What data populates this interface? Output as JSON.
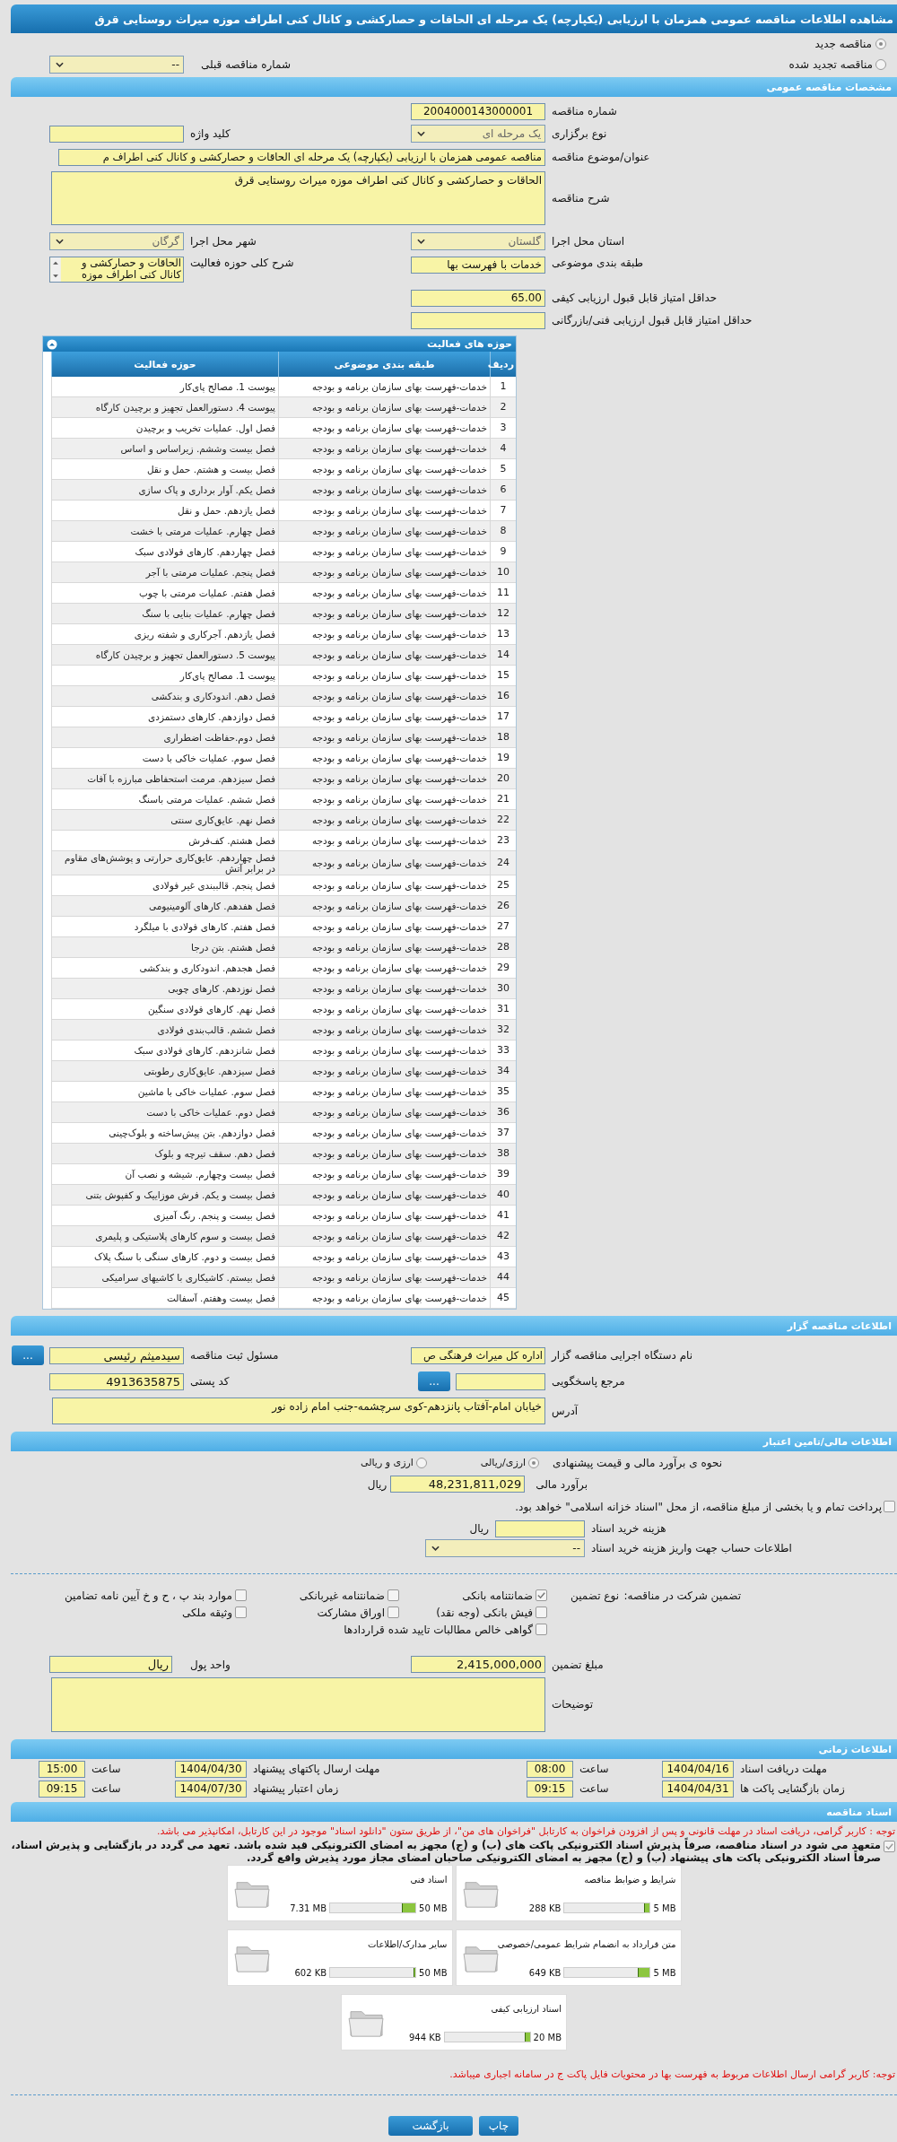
{
  "page_title": "مشاهده اطلاعات مناقصه عمومی همزمان با ارزیابی (یکپارچه) یک مرحله ای الحاقات و حصارکشی و کانال کنی اطراف موزه میراث روستایی قرق",
  "tender_kind": [
    {
      "label": "مناقصه جدید",
      "selected": true
    },
    {
      "label": "مناقصه تجدید شده",
      "selected": false
    }
  ],
  "previous_tender": {
    "label": "شماره مناقصه قبلی",
    "value": "--"
  },
  "general": {
    "header": "مشخصات مناقصه عمومی",
    "tender_number": {
      "label": "شماره مناقصه",
      "value": "2004000143000001"
    },
    "holding_type": {
      "label": "نوع برگزاری",
      "value": "یک مرحله ای"
    },
    "keyword": {
      "label": "کلید واژه"
    },
    "subject": {
      "label": "عنوان/موضوع مناقصه",
      "value": "مناقصه عمومی همزمان با ارزیابی (یکپارچه) یک مرحله ای الحاقات و حصارکشی و کانال کنی اطراف م"
    },
    "description": {
      "label": "شرح مناقصه",
      "value": "الحاقات و حصارکشی و کانال کنی اطراف موزه میراث روستایی قرق"
    },
    "province": {
      "label": "استان محل اجرا",
      "value": "گلستان"
    },
    "city": {
      "label": "شهر محل اجرا",
      "value": "گرگان"
    },
    "category": {
      "label": "طبقه بندی موضوعی",
      "value": "خدمات با فهرست بها"
    },
    "activity_summary": {
      "label": "شرح کلی حوزه فعالیت",
      "value": "الحاقات و حصارکشی و کانال کنی اطراف موزه"
    },
    "min_quality_score": {
      "label": "حداقل امتیاز قابل قبول ارزیابی کیفی",
      "value": "65.00"
    },
    "min_technical_score": {
      "label": "حداقل امتیاز قابل قبول ارزیابی فنی/بازرگانی"
    }
  },
  "activities": {
    "title": "حوزه های فعالیت",
    "columns": [
      "ردیف",
      "طبقه بندی موضوعی",
      "حوزه فعالیت"
    ],
    "rows": [
      {
        "index": "1",
        "category": "خدمات-فهرست بهای سازمان برنامه و بودجه",
        "activity": "پیوست 1. مصالح پای‌کار"
      },
      {
        "index": "2",
        "category": "خدمات-فهرست بهای سازمان برنامه و بودجه",
        "activity": "پیوست 4. دستورالعمل تجهیز و برچیدن کارگاه"
      },
      {
        "index": "3",
        "category": "خدمات-فهرست بهای سازمان برنامه و بودجه",
        "activity": "فصل اول. عملیات تخریب و برچیدن"
      },
      {
        "index": "4",
        "category": "خدمات-فهرست بهای سازمان برنامه و بودجه",
        "activity": "فصل بیست وششم. زیراساس و اساس"
      },
      {
        "index": "5",
        "category": "خدمات-فهرست بهای سازمان برنامه و بودجه",
        "activity": "فصل بیست و هشتم. حمل و نقل"
      },
      {
        "index": "6",
        "category": "خدمات-فهرست بهای سازمان برنامه و بودجه",
        "activity": "فصل یکم. آوار برداری و پاک سازی"
      },
      {
        "index": "7",
        "category": "خدمات-فهرست بهای سازمان برنامه و بودجه",
        "activity": "فصل یازدهم. حمل و نقل"
      },
      {
        "index": "8",
        "category": "خدمات-فهرست بهای سازمان برنامه و بودجه",
        "activity": "فصل چهارم. عملیات مرمتی با خشت"
      },
      {
        "index": "9",
        "category": "خدمات-فهرست بهای سازمان برنامه و بودجه",
        "activity": "فصل چهاردهم. کارهای فولادی سبک"
      },
      {
        "index": "10",
        "category": "خدمات-فهرست بهای سازمان برنامه و بودجه",
        "activity": "فصل پنجم.  عملیات مرمتی با آجر"
      },
      {
        "index": "11",
        "category": "خدمات-فهرست بهای سازمان برنامه و بودجه",
        "activity": "فصل هفتم. عملیات مرمتی با چوب"
      },
      {
        "index": "12",
        "category": "خدمات-فهرست بهای سازمان برنامه و بودجه",
        "activity": "فصل چهارم. عملیات بنایی با سنگ"
      },
      {
        "index": "13",
        "category": "خدمات-فهرست بهای سازمان برنامه و بودجه",
        "activity": "فصل یازدهم. آجرکاری و شفته ریزی"
      },
      {
        "index": "14",
        "category": "خدمات-فهرست بهای سازمان برنامه و بودجه",
        "activity": "پیوست 5. دستورالعمل تجهیز و برچیدن کارگاه"
      },
      {
        "index": "15",
        "category": "خدمات-فهرست بهای سازمان برنامه و بودجه",
        "activity": "پیوست 1. مصالح پای‌کار"
      },
      {
        "index": "16",
        "category": "خدمات-فهرست بهای سازمان برنامه و بودجه",
        "activity": "فصل دهم. اندودکاری و بندکشی"
      },
      {
        "index": "17",
        "category": "خدمات-فهرست بهای سازمان برنامه و بودجه",
        "activity": "فصل دوازدهم. کارهای دستمزدی"
      },
      {
        "index": "18",
        "category": "خدمات-فهرست بهای سازمان برنامه و بودجه",
        "activity": "فصل دوم.حفاظت اضطراری"
      },
      {
        "index": "19",
        "category": "خدمات-فهرست بهای سازمان برنامه و بودجه",
        "activity": "فصل سوم.  عملیات خاکی با دست"
      },
      {
        "index": "20",
        "category": "خدمات-فهرست بهای سازمان برنامه و بودجه",
        "activity": "فصل سیزدهم. مرمت استحفاظی مبارزه با آفات"
      },
      {
        "index": "21",
        "category": "خدمات-فهرست بهای سازمان برنامه و بودجه",
        "activity": "فصل ششم. عملیات مرمتی باسنگ"
      },
      {
        "index": "22",
        "category": "خدمات-فهرست بهای سازمان برنامه و بودجه",
        "activity": "فصل نهم. عایق‌کاری سنتی"
      },
      {
        "index": "23",
        "category": "خدمات-فهرست بهای سازمان برنامه و بودجه",
        "activity": "فصل هشتم. کف‌فرش"
      },
      {
        "index": "24",
        "category": "خدمات-فهرست بهای سازمان برنامه و بودجه",
        "activity": "فصل چهاردهم. عایق‌کاری حرارتی و پوشش‌های مقاوم در برابر آتش"
      },
      {
        "index": "25",
        "category": "خدمات-فهرست بهای سازمان برنامه و بودجه",
        "activity": "فصل پنجم. قالببندی غیر فولادی"
      },
      {
        "index": "26",
        "category": "خدمات-فهرست بهای سازمان برنامه و بودجه",
        "activity": "فصل هفدهم. کارهای آلومینیومی"
      },
      {
        "index": "27",
        "category": "خدمات-فهرست بهای سازمان برنامه و بودجه",
        "activity": "فصل هفتم. کارهای فولادی با میلگرد"
      },
      {
        "index": "28",
        "category": "خدمات-فهرست بهای سازمان برنامه و بودجه",
        "activity": "فصل هشتم. بتن درجا"
      },
      {
        "index": "29",
        "category": "خدمات-فهرست بهای سازمان برنامه و بودجه",
        "activity": "فصل هجدهم. اندودکاری و بندکشی"
      },
      {
        "index": "30",
        "category": "خدمات-فهرست بهای سازمان برنامه و بودجه",
        "activity": "فصل نوزدهم. کارهای چوبی"
      },
      {
        "index": "31",
        "category": "خدمات-فهرست بهای سازمان برنامه و بودجه",
        "activity": "فصل نهم. کارهای فولادی سنگین"
      },
      {
        "index": "32",
        "category": "خدمات-فهرست بهای سازمان برنامه و بودجه",
        "activity": "فصل ششم. قالب‌بندی فولادی"
      },
      {
        "index": "33",
        "category": "خدمات-فهرست بهای سازمان برنامه و بودجه",
        "activity": "فصل شانزدهم. کارهای فولادی سبک"
      },
      {
        "index": "34",
        "category": "خدمات-فهرست بهای سازمان برنامه و بودجه",
        "activity": "فصل سیزدهم. عایق‌کاری رطوبتی"
      },
      {
        "index": "35",
        "category": "خدمات-فهرست بهای سازمان برنامه و بودجه",
        "activity": "فصل سوم. عملیات خاکی با ماشین"
      },
      {
        "index": "36",
        "category": "خدمات-فهرست بهای سازمان برنامه و بودجه",
        "activity": "فصل دوم. عملیات خاکی با دست"
      },
      {
        "index": "37",
        "category": "خدمات-فهرست بهای سازمان برنامه و بودجه",
        "activity": "فصل دوازدهم. بتن پیش‌ساخته و بلوک‌چینی"
      },
      {
        "index": "38",
        "category": "خدمات-فهرست بهای سازمان برنامه و بودجه",
        "activity": "فصل دهم. سقف تیرچه و بلوک"
      },
      {
        "index": "39",
        "category": "خدمات-فهرست بهای سازمان برنامه و بودجه",
        "activity": "فصل بیست وچهارم. شیشه و نصب آن"
      },
      {
        "index": "40",
        "category": "خدمات-فهرست بهای سازمان برنامه و بودجه",
        "activity": "فصل بیست و یکم. فرش موزاییک و کفپوش بتنی"
      },
      {
        "index": "41",
        "category": "خدمات-فهرست بهای سازمان برنامه و بودجه",
        "activity": "فصل بیست و پنجم. رنگ آمیزی"
      },
      {
        "index": "42",
        "category": "خدمات-فهرست بهای سازمان برنامه و بودجه",
        "activity": "فصل بیست و سوم کارهای پلاستیکی و پلیمری"
      },
      {
        "index": "43",
        "category": "خدمات-فهرست بهای سازمان برنامه و بودجه",
        "activity": "فصل بیست و دوم. کارهای سنگی با سنگ پلاک"
      },
      {
        "index": "44",
        "category": "خدمات-فهرست بهای سازمان برنامه و بودجه",
        "activity": "فصل بیستم. کاشیکاری با کاشیهای سرامیکی"
      },
      {
        "index": "45",
        "category": "خدمات-فهرست بهای سازمان برنامه و بودجه",
        "activity": "فصل بیست وهفتم. آسفالت"
      }
    ]
  },
  "organizer": {
    "header": "اطلاعات مناقصه گزار",
    "executive_org": {
      "label": "نام دستگاه اجرایی مناقصه گزار",
      "value": "اداره کل میراث فرهنگی  ص"
    },
    "registrar": {
      "label": "مسئول ثبت مناقصه",
      "value": "سیدمیثم رئیسی",
      "button": "..."
    },
    "reference": {
      "label": "مرجع پاسخگویی",
      "button": "..."
    },
    "postal_code": {
      "label": "کد پستی",
      "value": "4913635875"
    },
    "address": {
      "label": "آدرس",
      "value": "خیابان امام-آفتاب پانزدهم-کوی سرچشمه-جنب امام زاده نور"
    }
  },
  "financial": {
    "header": "اطلاعات مالی/تامین اعتبار",
    "estimate_method": {
      "label": "نحوه ی برآورد مالی و قیمت پیشنهادی",
      "options": [
        {
          "label": "ارزی/ریالی",
          "selected": true
        },
        {
          "label": "ارزی و ریالی",
          "selected": false
        }
      ]
    },
    "estimate": {
      "label": "برآورد مالی",
      "value": "48,231,811,029",
      "unit": "ریال"
    },
    "treasury": {
      "label": "پرداخت تمام و یا بخشی از مبلغ مناقصه، از محل \"اسناد خزانه اسلامی\" خواهد بود.",
      "checked": false
    },
    "document_cost": {
      "label": "هزینه خرید اسناد",
      "unit": "ریال"
    },
    "account": {
      "label": "اطلاعات حساب جهت واریز هزینه خرید اسناد",
      "value": "--"
    },
    "guarantee": {
      "label": "تضمین شرکت در مناقصه:",
      "type_label": "نوع تضمین",
      "options": [
        {
          "label": "ضمانتنامه بانکی",
          "checked": true
        },
        {
          "label": "ضمانتنامه غیربانکی",
          "checked": false
        },
        {
          "label": "موارد بند پ ، ح و خ آیین نامه تضامین",
          "checked": false
        },
        {
          "label": "فیش بانکی (وجه نقد)",
          "checked": false
        },
        {
          "label": "اوراق مشارکت",
          "checked": false
        },
        {
          "label": "وثیقه ملکی",
          "checked": false
        },
        {
          "label": "گواهی خالص مطالبات تایید شده قراردادها",
          "checked": false
        }
      ]
    },
    "guarantee_amount": {
      "label": "مبلغ تضمین",
      "value": "2,415,000,000"
    },
    "currency": {
      "label": "واحد پول",
      "value": "ریال"
    },
    "notes": {
      "label": "توضیحات"
    }
  },
  "timing": {
    "header": "اطلاعات زمانی",
    "items": [
      {
        "label": "مهلت دریافت اسناد",
        "date": "1404/04/16",
        "time_label": "ساعت",
        "time": "08:00"
      },
      {
        "label": "مهلت ارسال پاکتهای پیشنهاد",
        "date": "1404/04/30",
        "time_label": "ساعت",
        "time": "15:00"
      },
      {
        "label": "زمان بازگشایی پاکت ها",
        "date": "1404/04/31",
        "time_label": "ساعت",
        "time": "09:15"
      },
      {
        "label": "زمان اعتبار پیشنهاد",
        "date": "1404/07/30",
        "time_label": "ساعت",
        "time": "09:15"
      }
    ]
  },
  "documents": {
    "header": "اسناد مناقصه",
    "notice": "توجه : کاربر گرامی، دریافت اسناد در مهلت قانونی و پس از افزودن فراخوان به کارتابل \"فراخوان های من\"، از طریق ستون \"دانلود اسناد\" موجود در این کارتابل، امکانپذیر می باشد.",
    "commitment": {
      "label": "متعهد می شود در اسناد مناقصه، صرفاً پذیرش اسناد الکترونیکی پاکت های (ب) و (ج) مجهز به امضای الکترونیکی قید شده باشد. تعهد می گردد در بازگشایی و پذیرش اسناد، صرفاً اسناد الکترونیکی پاکت های پیشنهاد (ب) و (ج) مجهز به امضای الکترونیکی صاحبان امضای مجاز مورد پذیرش واقع گردد.",
      "checked": true
    },
    "files": [
      {
        "title": "شرایط و ضوابط مناقصه",
        "size": "288 KB",
        "max": "5 MB",
        "level": 0.056
      },
      {
        "title": "اسناد فنی",
        "size": "7.31 MB",
        "max": "50 MB",
        "level": 0.146
      },
      {
        "title": "متن قرارداد به انضمام شرایط عمومی/خصوصی",
        "size": "649 KB",
        "max": "5 MB",
        "level": 0.127
      },
      {
        "title": "سایر مدارک/اطلاعات",
        "size": "602 KB",
        "max": "50 MB",
        "level": 0.012
      },
      {
        "title": "اسناد ارزیابی کیفی",
        "size": "944 KB",
        "max": "20 MB",
        "level": 0.046
      }
    ],
    "footer_notice": "توجه: کاربر گرامی ارسال اطلاعات مربوط به فهرست بها در محتویات فایل پاکت ج در سامانه اجباری میباشد."
  },
  "buttons": [
    {
      "label": "چاپ"
    },
    {
      "label": "بازگشت"
    }
  ]
}
